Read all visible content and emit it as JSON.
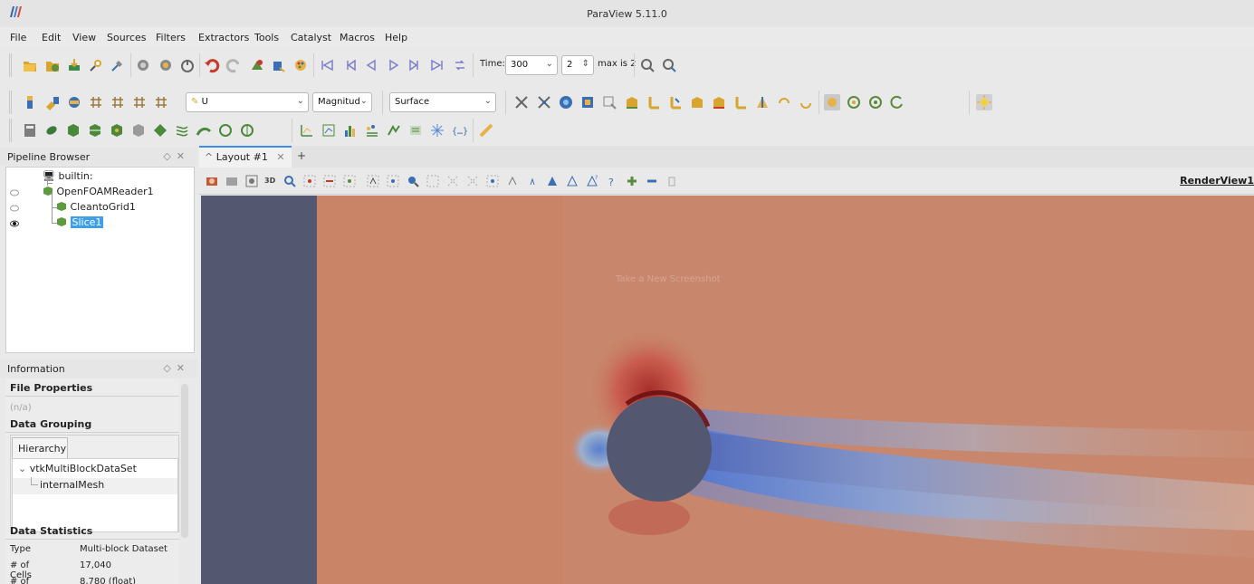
{
  "window": {
    "title": "ParaView 5.11.0"
  },
  "menu": [
    "File",
    "Edit",
    "View",
    "Sources",
    "Filters",
    "Extractors",
    "Tools",
    "Catalyst",
    "Macros",
    "Help"
  ],
  "time_toolbar": {
    "time_label": "Time:",
    "time_value": "300",
    "step_value": "2",
    "max_label": "max is 2"
  },
  "color_toolbar": {
    "array": "U",
    "component": "Magnitud",
    "representation": "Surface"
  },
  "pipeline_browser": {
    "title": "Pipeline Browser",
    "items": [
      "builtin:",
      "OpenFOAMReader1",
      "CleantoGrid1",
      "Slice1"
    ],
    "selected": "Slice1"
  },
  "information": {
    "title": "Information",
    "file_properties": "File Properties",
    "file_value": "(n/a)",
    "data_grouping": "Data Grouping",
    "tab": "Hierarchy",
    "hierarchy": [
      "vtkMultiBlockDataSet",
      "internalMesh"
    ],
    "data_statistics": "Data Statistics",
    "stats": [
      {
        "key": "Type",
        "value": "Multi-block Dataset"
      },
      {
        "key": "# of Cells",
        "value": "17,040"
      },
      {
        "key": "# of Points",
        "value": "8,780 (float)"
      }
    ]
  },
  "layout": {
    "tab_label": "Layout #1",
    "new_tab": "+",
    "view_label": "RenderView1",
    "tooltip": "Take a New Screenshot"
  },
  "colors": {
    "accent": "#3d8ee6",
    "background_field": "#c98468",
    "cylinder": "#535870",
    "selection": "#3f9fe6"
  }
}
